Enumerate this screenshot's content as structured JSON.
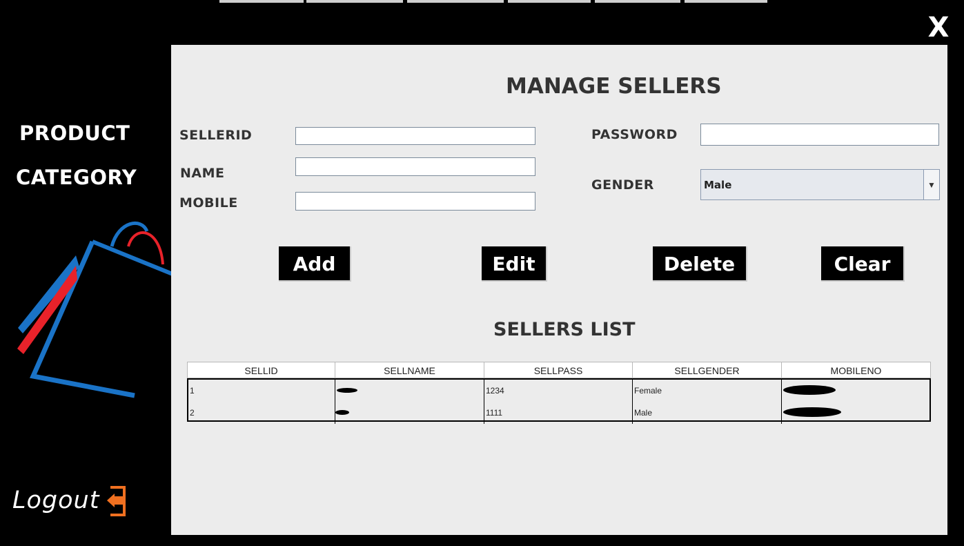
{
  "window": {
    "close_label": "X"
  },
  "sidebar": {
    "nav_items": [
      {
        "label": "PRODUCT"
      },
      {
        "label": "CATEGORY"
      }
    ],
    "logout_label": "Logout"
  },
  "form": {
    "title": "MANAGE SELLERS",
    "sellerid_label": "SELLERID",
    "sellerid_value": "",
    "name_label": "NAME",
    "name_value": "",
    "mobile_label": "MOBILE",
    "mobile_value": "",
    "password_label": "PASSWORD",
    "password_value": "",
    "gender_label": "GENDER",
    "gender_value": "Male"
  },
  "buttons": {
    "add": "Add",
    "edit": "Edit",
    "delete": "Delete",
    "clear": "Clear"
  },
  "list": {
    "title": "SELLERS LIST",
    "columns": [
      "SELLID",
      "SELLNAME",
      "SELLPASS",
      "SELLGENDER",
      "MOBILENO"
    ],
    "rows": [
      {
        "sellid": "1",
        "sellpass": "1234",
        "sellgender": "Female"
      },
      {
        "sellid": "2",
        "sellpass": "1111",
        "sellgender": "Male"
      }
    ]
  },
  "colors": {
    "background": "#000000",
    "panel": "#ececec",
    "logo_blue": "#1a73c7",
    "logo_red": "#e8222a",
    "logout_icon": "#f07020"
  }
}
